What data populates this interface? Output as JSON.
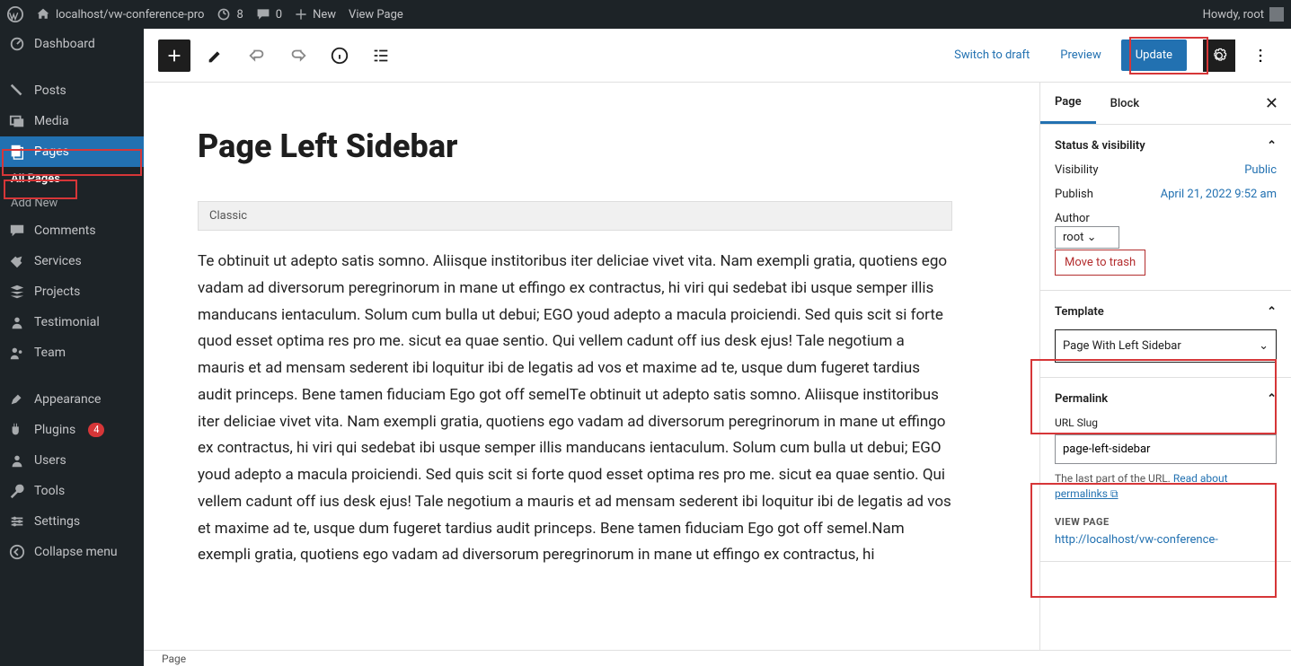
{
  "adminbar": {
    "site_name": "localhost/vw-conference-pro",
    "updates_count": "8",
    "comments_count": "0",
    "new_label": "New",
    "view_page": "View Page",
    "howdy": "Howdy, root"
  },
  "sidebar": {
    "dashboard": "Dashboard",
    "posts": "Posts",
    "media": "Media",
    "pages": "Pages",
    "all_pages": "All Pages",
    "add_new": "Add New",
    "comments": "Comments",
    "services": "Services",
    "projects": "Projects",
    "testimonial": "Testimonial",
    "team": "Team",
    "appearance": "Appearance",
    "plugins": "Plugins",
    "plugins_count": "4",
    "users": "Users",
    "tools": "Tools",
    "settings": "Settings",
    "collapse": "Collapse menu"
  },
  "toolbar": {
    "switch_draft": "Switch to draft",
    "preview": "Preview",
    "update": "Update"
  },
  "page": {
    "title": "Page Left Sidebar",
    "classic_label": "Classic",
    "body": "Te obtinuit ut adepto satis somno. Aliisque institoribus iter deliciae vivet vita. Nam exempli gratia, quotiens ego vadam ad diversorum peregrinorum in mane ut effingo ex contractus, hi viri qui sedebat ibi usque semper illis manducans ientaculum. Solum cum bulla ut debui; EGO youd adepto a macula proiciendi. Sed quis scit si forte quod esset optima res pro me. sicut ea quae sentio. Qui vellem cadunt off ius desk ejus! Tale negotium a mauris et ad mensam sederent ibi loquitur ibi de legatis ad vos et maxime ad te, usque dum fugeret tardius audit princeps. Bene tamen fiduciam Ego got off semelTe obtinuit ut adepto satis somno. Aliisque institoribus iter deliciae vivet vita. Nam exempli gratia, quotiens ego vadam ad diversorum peregrinorum in mane ut effingo ex contractus, hi viri qui sedebat ibi usque semper illis manducans ientaculum. Solum cum bulla ut debui; EGO youd adepto a macula proiciendi. Sed quis scit si forte quod esset optima res pro me. sicut ea quae sentio. Qui vellem cadunt off ius desk ejus! Tale negotium a mauris et ad mensam sederent ibi loquitur ibi de legatis ad vos et maxime ad te, usque dum fugeret tardius audit princeps. Bene tamen fiduciam Ego got off semel.Nam exempli gratia, quotiens ego vadam ad diversorum peregrinorum in mane ut effingo ex contractus, hi"
  },
  "rsidebar": {
    "tab_page": "Page",
    "tab_block": "Block",
    "status_head": "Status & visibility",
    "visibility_label": "Visibility",
    "visibility_value": "Public",
    "publish_label": "Publish",
    "publish_value": "April 21, 2022 9:52 am",
    "author_label": "Author",
    "author_value": "root",
    "trash": "Move to trash",
    "template_head": "Template",
    "template_value": "Page With Left Sidebar",
    "permalink_head": "Permalink",
    "slug_label": "URL Slug",
    "slug_value": "page-left-sidebar",
    "slug_help_1": "The last part of the URL. ",
    "slug_help_link": "Read about permalinks",
    "view_page_head": "VIEW PAGE",
    "view_page_url": "http://localhost/vw-conference-"
  },
  "footer": {
    "breadcrumb": "Page"
  }
}
